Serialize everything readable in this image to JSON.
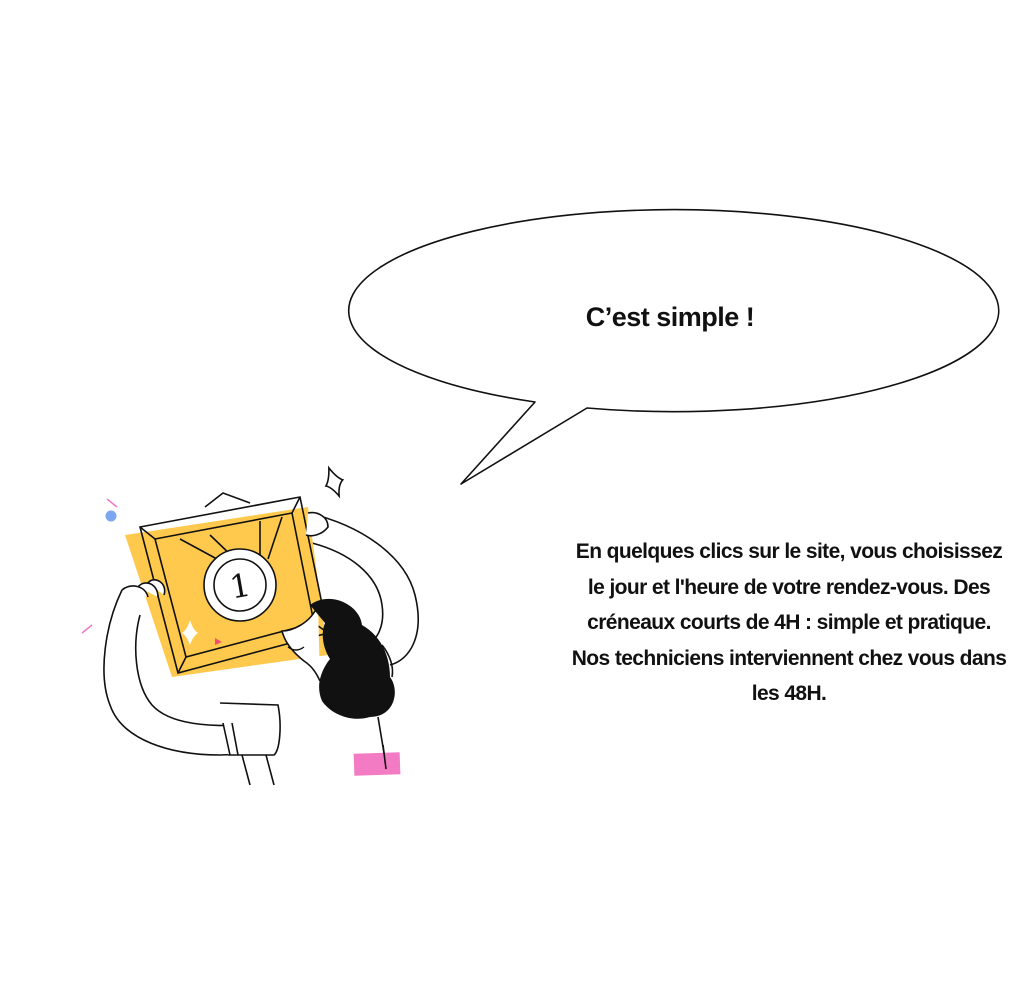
{
  "speech_bubble": {
    "text": "C’est simple !"
  },
  "description": {
    "text": "En quelques clics sur le site, vous choisissez le jour et l'heure de votre rendez-vous. Des créneaux courts de 4H : simple et pratique. Nos techniciens interviennent chez vous dans les 48H."
  },
  "illustration": {
    "icon": "person-holding-award-frame-icon",
    "medal_number": "1"
  },
  "colors": {
    "frame_yellow": "#FFC94D",
    "accent_pink": "#F27BC4",
    "accent_blue": "#7AA7F0",
    "ink": "#111111"
  }
}
